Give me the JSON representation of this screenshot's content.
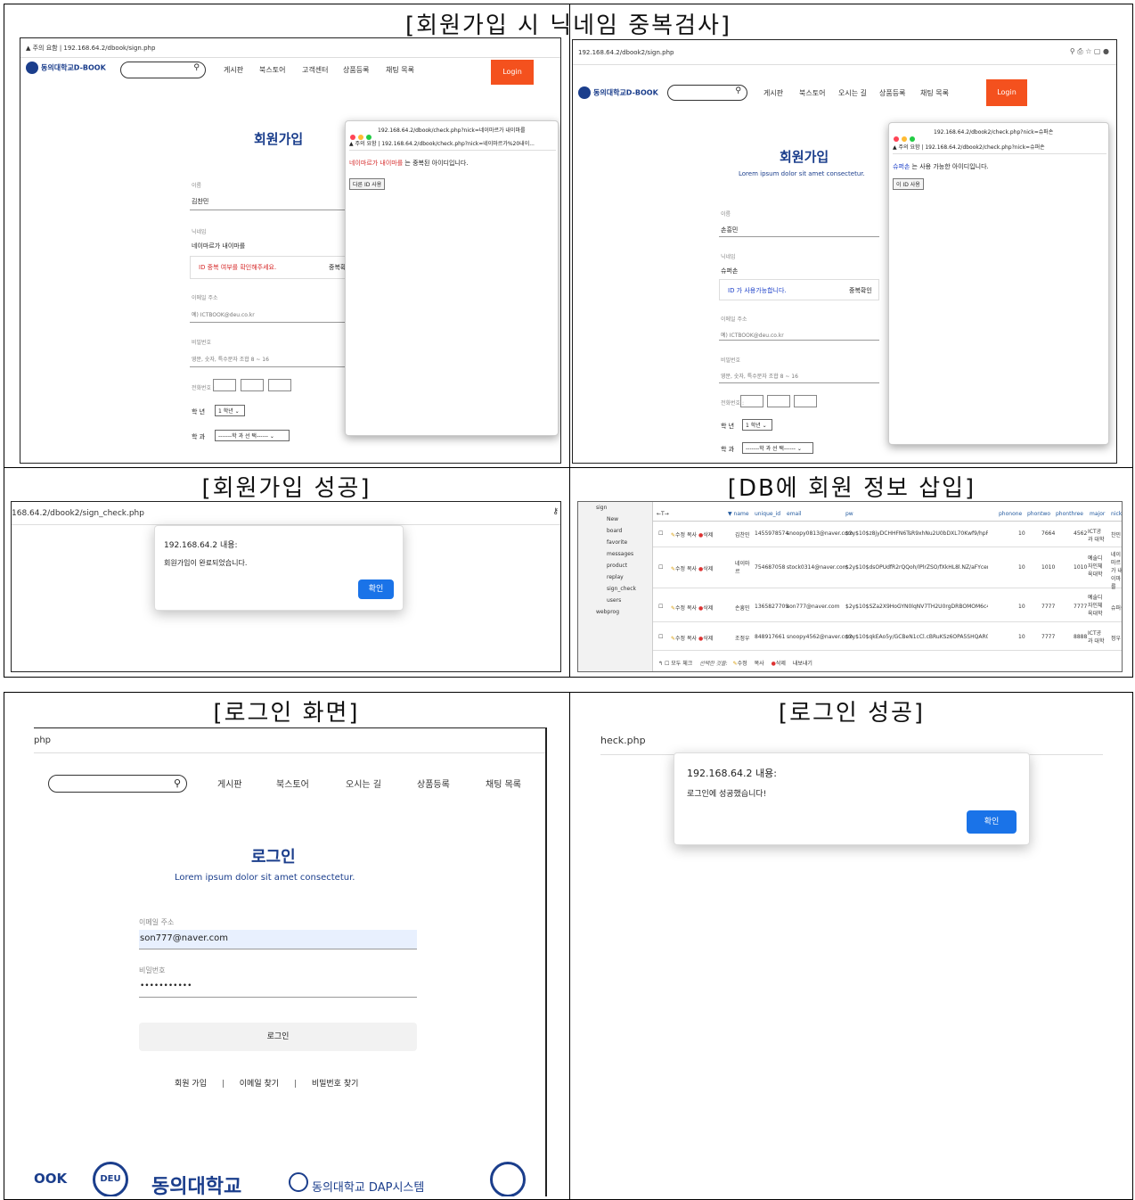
{
  "captions": {
    "nickname_check": "[회원가입 시 닉네임 중복검사]",
    "signup_success": "[회원가입 성공]",
    "db_insert": "[DB에 회원 정보 삽입]",
    "login_screen": "[로그인 화면]",
    "login_success": "[로그인 성공]"
  },
  "shot1": {
    "url": "▲ 주의 요함 | 192.168.64.2/dbook/sign.php",
    "logo": "동의대학교D-BOOK",
    "nav": [
      "게시판",
      "북스토어",
      "고객센터",
      "상품등록",
      "채팅 목록"
    ],
    "login": "Login",
    "title": "회원가입",
    "name_label": "이름",
    "name_value": "김찬민",
    "nick_label": "닉네임",
    "nick_value": "네이마르가 내이마를",
    "nick_warn": "ID 중복 여부를 확인해주세요.",
    "nick_check": "중복확",
    "email_label": "이메일 주소",
    "email_value": "예) ICTBOOK@deu.co.kr",
    "pw_label": "비밀번호",
    "pw_value": "영문, 숫자, 특수문자 조합 8 ~ 16",
    "phone_label": "전화번호 :",
    "grade_label": "학 년",
    "grade_value": "1 학년",
    "major_label": "학 과",
    "major_value": "-------학 과 선 택------",
    "popup_url_title": "192.168.64.2/dbook/check.php?nick=네이마르가 내이마를",
    "popup_url": "▲ 주의 요함 | 192.168.64.2/dbook/check.php?nick=네이마르가%20내이...",
    "popup_msg_nick": "네이마르가 내이마를",
    "popup_msg_rest": " 는 중복된 아이디입니다.",
    "popup_btn": "다른 ID 사용"
  },
  "shot2": {
    "url": "192.168.64.2/dbook2/sign.php",
    "logo": "동의대학교D-BOOK",
    "nav": [
      "게시판",
      "북스토어",
      "오시는 길",
      "상품등록",
      "채팅 목록"
    ],
    "login": "Login",
    "title": "회원가입",
    "subtitle": "Lorem ipsum dolor sit amet consectetur.",
    "name_label": "이름",
    "name_value": "손흥민",
    "nick_label": "닉네임",
    "nick_value": "슈퍼손",
    "nick_ok": "ID 가 사용가능합니다.",
    "nick_check": "중복확인",
    "email_label": "이메일 주소",
    "email_value": "예) ICTBOOK@deu.co.kr",
    "pw_label": "비밀번호",
    "pw_value": "영문, 숫자, 특수문자 조합 8 ~ 16",
    "phone_label": "전화번호 :",
    "grade_label": "학 년",
    "grade_value": "1 학년",
    "major_label": "학 과",
    "major_value": "-------학 과 선 택------",
    "popup_url_title": "192.168.64.2/dbook2/check.php?nick=슈퍼손",
    "popup_url": "▲ 주의 요함 | 192.168.64.2/dbook2/check.php?nick=슈퍼손",
    "popup_msg_nick": "슈퍼손",
    "popup_msg_rest": " 는 사용 가능한 아이디입니다.",
    "popup_btn": "이 ID 사용"
  },
  "shot3": {
    "url": "168.64.2/dbook2/sign_check.php",
    "dialog_title": "192.168.64.2 내용:",
    "dialog_msg": "회원가입이 완료되었습니다.",
    "ok": "확인"
  },
  "shot4": {
    "tree": [
      "sign",
      "New",
      "board",
      "favorite",
      "messages",
      "product",
      "replay",
      "sign_check",
      "users",
      "webprog"
    ],
    "columns": [
      "name",
      "unique_id",
      "email",
      "pw",
      "phonone",
      "phontwo",
      "phonthree",
      "major",
      "nick"
    ],
    "rows": [
      {
        "name": "김찬민",
        "uid": "1455978574",
        "email": "snoopy0813@naver.com",
        "pw": "$2y$10$z8jyDCHHFN6TsR9xhNu2U0bDXL70Kwf9/hpFsf25/Tb...",
        "p1": "10",
        "p2": "7664",
        "p3": "4562",
        "major": "ICT공과 대학",
        "nick": "찬민"
      },
      {
        "name": "네이마 르",
        "uid": "754687058",
        "email": "stock0314@naver.com",
        "pw": "$2y$10$dsOPUdfR2rQQoh/lPlrZSO/fXkHL8l.NZ/aFYcem0...",
        "p1": "10",
        "p2": "1010",
        "p3": "1010",
        "major": "예술디 자인체 육대학",
        "nick": "네이마르가 내이마를"
      },
      {
        "name": "손흥민",
        "uid": "1365827709",
        "email": "son777@naver.com",
        "pw": "$2y$10$SZa2X9HoGYN0lqNV7TH2U0rgDRBOMOM6c4MDL12lsC/...",
        "p1": "10",
        "p2": "7777",
        "p3": "7777",
        "major": "예술디 자인체 육대학",
        "nick": "슈퍼손"
      },
      {
        "name": "조정우",
        "uid": "848917661",
        "email": "snoopy4562@naver.com",
        "pw": "$2y$10$qkEAo5y/GCBeN1cCl.cBRuKSz6OPA5SHQAR0HV.XOpb...",
        "p1": "10",
        "p2": "7777",
        "p3": "8888",
        "major": "ICT공과 대학",
        "nick": "정우"
      }
    ],
    "row_actions": [
      "수정",
      "복사",
      "삭제"
    ],
    "footer": [
      "모두 체크",
      "선택한 것을:",
      "수정",
      "복사",
      "삭제",
      "내보내기"
    ]
  },
  "shot5": {
    "url": "php",
    "nav": [
      "게시판",
      "북스토어",
      "오시는 길",
      "상품등록",
      "채팅 목록"
    ],
    "title": "로그인",
    "subtitle": "Lorem ipsum dolor sit amet consectetur.",
    "email_label": "이메일 주소",
    "email_value": "son777@naver.com",
    "pw_label": "비밀번호",
    "pw_value": "•••••••••••",
    "login_btn": "로그인",
    "links": [
      "회원 가입",
      "|",
      "이메일 찾기",
      "|",
      "비밀번호 찾기"
    ],
    "footer_left": "OOK",
    "footer_univ": "동의대학교",
    "footer_dap": "동의대학교 DAP시스템"
  },
  "shot6": {
    "url": "heck.php",
    "dialog_title": "192.168.64.2 내용:",
    "dialog_msg": "로그인에 성공했습니다!",
    "ok": "확인"
  },
  "colors": {
    "accent_orange": "#f4511e",
    "navy": "#1b3e8c",
    "blue": "#1a73e8",
    "red": "#d62828"
  }
}
